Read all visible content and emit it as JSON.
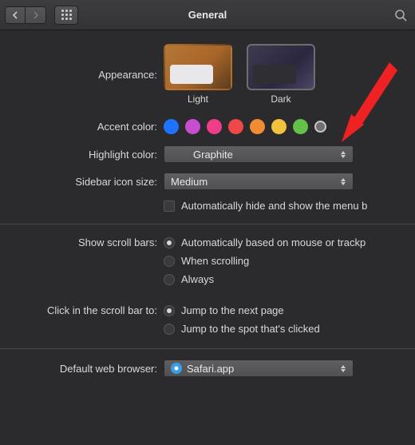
{
  "header": {
    "title": "General"
  },
  "appearance": {
    "label": "Appearance:",
    "light": "Light",
    "dark": "Dark"
  },
  "accent": {
    "label": "Accent color:",
    "colors": [
      "#1e74ff",
      "#c84dd1",
      "#ef3d8a",
      "#ee4848",
      "#f08c32",
      "#f2c23c",
      "#64c148"
    ]
  },
  "highlight": {
    "label": "Highlight color:",
    "value": "Graphite"
  },
  "sidebar_size": {
    "label": "Sidebar icon size:",
    "value": "Medium"
  },
  "menubar_autohide": "Automatically hide and show the menu b",
  "scrollbars": {
    "label": "Show scroll bars:",
    "opt1": "Automatically based on mouse or trackp",
    "opt2": "When scrolling",
    "opt3": "Always"
  },
  "click_scrollbar": {
    "label": "Click in the scroll bar to:",
    "opt1": "Jump to the next page",
    "opt2": "Jump to the spot that's clicked"
  },
  "browser": {
    "label": "Default web browser:",
    "value": "Safari.app"
  }
}
